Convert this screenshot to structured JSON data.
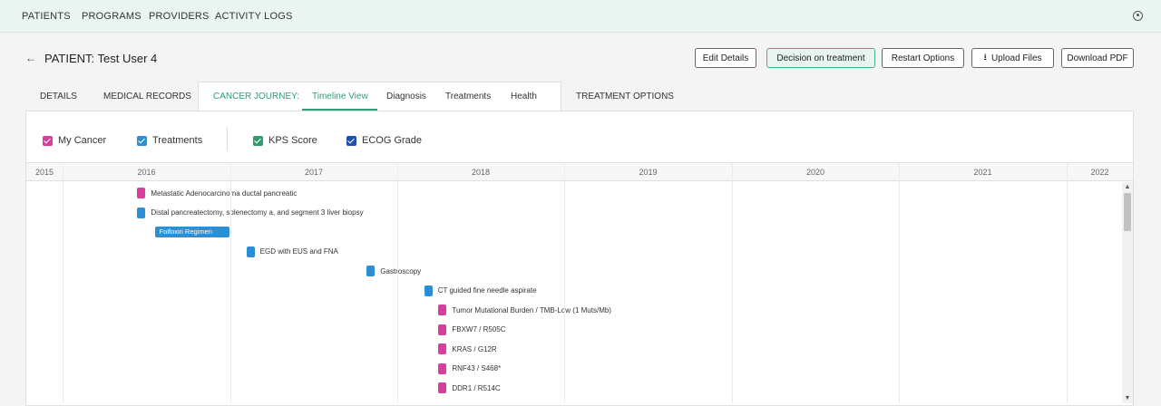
{
  "nav": {
    "items": [
      "PATIENTS",
      "PROGRAMS",
      "PROVIDERS",
      "ACTIVITY LOGS"
    ],
    "user_icon": "user-circle-icon"
  },
  "patient": {
    "back_icon": "arrow-left-icon",
    "back_glyph": "←",
    "title": "PATIENT: Test User 4"
  },
  "actions": {
    "edit": "Edit Details",
    "decision": "Decision on treatment",
    "restart": "Restart Options",
    "upload": "Upload Files",
    "upload_icon": "upload-icon",
    "upload_glyph": "⭳",
    "download": "Download PDF"
  },
  "tabs": {
    "details": "DETAILS",
    "medical_records": "MEDICAL RECORDS",
    "journey_label": "CANCER JOURNEY:",
    "timeline_view": "Timeline View",
    "diagnosis": "Diagnosis",
    "treatments": "Treatments",
    "health": "Health",
    "treatment_options": "TREATMENT OPTIONS",
    "active": "Timeline View"
  },
  "colors": {
    "accent": "#2e9e72",
    "my_cancer": "#d63f9b",
    "treatments": "#2a8fd4",
    "kps": "#2e9e72",
    "ecog": "#1f4fb0",
    "timeline_bar": "#2a8fd4"
  },
  "legend": [
    {
      "label": "My Cancer",
      "checked": true
    },
    {
      "label": "Treatments",
      "checked": true
    },
    {
      "label": "KPS Score",
      "checked": true
    },
    {
      "label": "ECOG Grade",
      "checked": true
    }
  ],
  "timeline": {
    "years": [
      "2015",
      "2016",
      "2017",
      "2018",
      "2019",
      "2020",
      "2021",
      "2022"
    ],
    "events": [
      {
        "label": "Metastatic Adenocarcinoma ductal pancreatic",
        "category": "My Cancer",
        "date": "2016-06-12"
      },
      {
        "label": "Distal pancreatectomy, splenectomy a, and segment 3 liver biopsy",
        "category": "Treatments",
        "date": "2016-06-12"
      },
      {
        "label": "Folfoxiri Regimen",
        "category": "Treatments",
        "start": "2016-07-20",
        "end": "2016-12-31"
      },
      {
        "label": "EGD with EUS and FNA",
        "category": "Treatments",
        "date": "2017-02-05"
      },
      {
        "label": "Gastroscopy",
        "category": "Treatments",
        "date": "2017-10-26"
      },
      {
        "label": "CT guided fine needle aspirate",
        "category": "Treatments",
        "date": "2018-03-01"
      },
      {
        "label": "Tumor Mutational Burden / TMB-Low (1 Muts/Mb)",
        "category": "My Cancer",
        "date": "2018-04-01"
      },
      {
        "label": "FBXW7 / R505C",
        "category": "My Cancer",
        "date": "2018-04-01"
      },
      {
        "label": "KRAS / G12R",
        "category": "My Cancer",
        "date": "2018-04-01"
      },
      {
        "label": "RNF43 / S468*",
        "category": "My Cancer",
        "date": "2018-04-01"
      },
      {
        "label": "DDR1 / R514C",
        "category": "My Cancer",
        "date": "2018-04-01"
      }
    ]
  },
  "scrollbar": {
    "up_glyph": "▲",
    "down_glyph": "▼"
  }
}
